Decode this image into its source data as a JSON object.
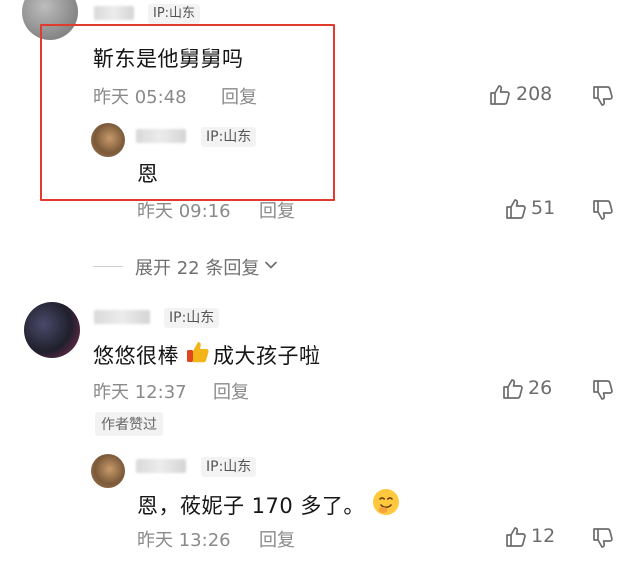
{
  "comments": [
    {
      "ip": "IP:山东",
      "text": "靳东是他舅舅吗",
      "time": "昨天 05:48",
      "reply_label": "回复",
      "likes": "208"
    },
    {
      "ip": "IP:山东",
      "text": "恩",
      "time": "昨天 09:16",
      "reply_label": "回复",
      "likes": "51"
    },
    {
      "expand_label": "展开 22 条回复"
    },
    {
      "ip": "IP:山东",
      "text_before": "悠悠很棒",
      "text_after": "成大孩子啦",
      "time": "昨天 12:37",
      "reply_label": "回复",
      "likes": "26",
      "author_tag": "作者赞过"
    },
    {
      "ip": "IP:山东",
      "text": "恩，莜妮子 170 多了。",
      "time": "昨天 13:26",
      "reply_label": "回复",
      "likes": "12"
    }
  ],
  "colors": {
    "highlight_border": "#e33a2f",
    "secondary_text": "#8a8a8a"
  },
  "icons": [
    "thumb-up-icon",
    "thumb-down-icon",
    "chevron-down-icon",
    "thumbs-up-emoji",
    "smile-emoji"
  ]
}
